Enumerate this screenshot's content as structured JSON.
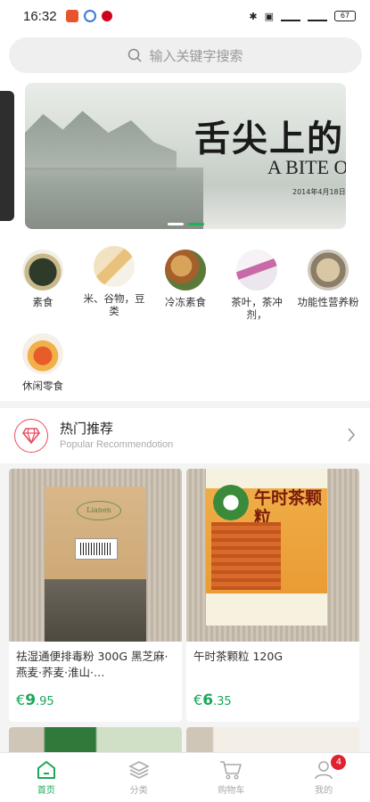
{
  "status_bar": {
    "time": "16:32",
    "battery": "67"
  },
  "search": {
    "placeholder": "输入关键字搜索"
  },
  "banner": {
    "title": "舌尖上的",
    "subtitle": "A BITE O",
    "date": "2014年4月18日"
  },
  "categories": [
    {
      "label": "素食"
    },
    {
      "label": "米、谷物，豆类"
    },
    {
      "label": "冷冻素食"
    },
    {
      "label": "茶叶，茶冲剂，"
    },
    {
      "label": "功能性营养粉"
    },
    {
      "label": "休闲零食"
    }
  ],
  "section": {
    "title": "热门推荐",
    "subtitle": "Popular Recommendotion"
  },
  "products": [
    {
      "name": "祛湿通便排毒粉 300G 黑芝麻·燕麦·荞麦·淮山·…",
      "currency": "€",
      "price_int": "9",
      "price_dec": ".95",
      "package_text": "Lianen"
    },
    {
      "name": "午时茶颗粒 120G",
      "currency": "€",
      "price_int": "6",
      "price_dec": ".35",
      "package_text": "午时茶颗粒"
    }
  ],
  "tabs": [
    {
      "label": "首页",
      "icon": "home-icon",
      "active": true
    },
    {
      "label": "分类",
      "icon": "layers-icon"
    },
    {
      "label": "购物车",
      "icon": "cart-icon"
    },
    {
      "label": "我的",
      "icon": "user-icon",
      "badge": "4"
    }
  ],
  "colors": {
    "accent": "#19a85a",
    "badge": "#e0212f",
    "section_icon": "#e94d5f"
  }
}
